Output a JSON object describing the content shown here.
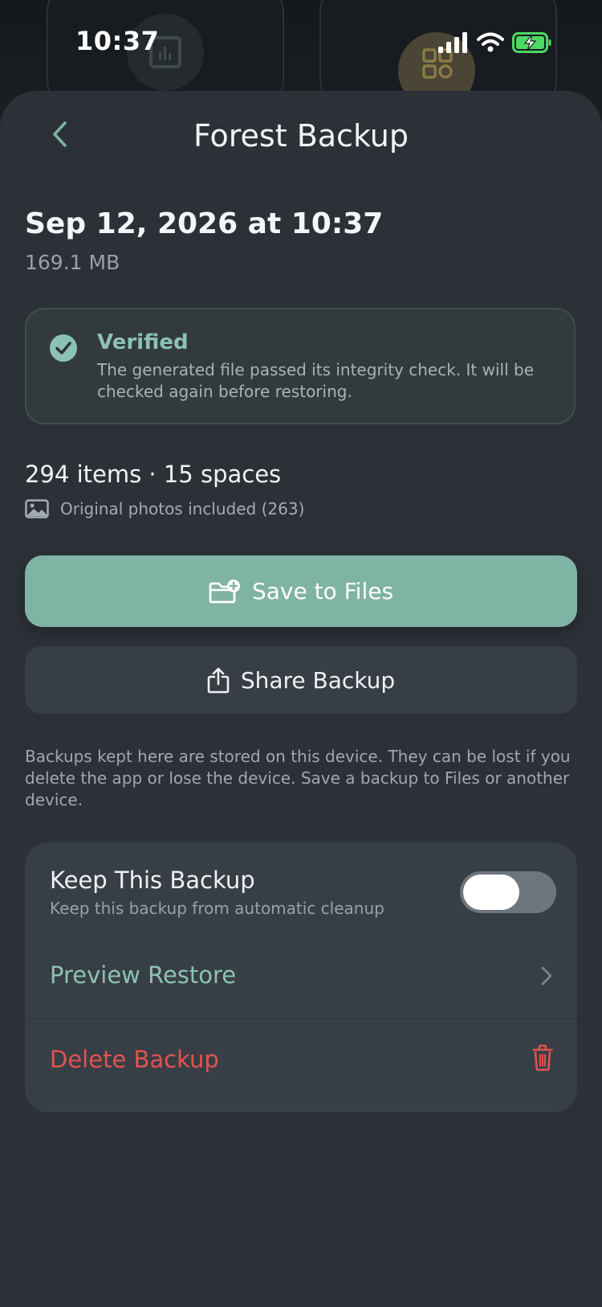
{
  "status_bar": {
    "time": "10:37"
  },
  "nav": {
    "title": "Forest Backup"
  },
  "backup": {
    "date": "Sep 12, 2026 at 10:37",
    "size": "169.1 MB"
  },
  "verified": {
    "title": "Verified",
    "text": "The generated file passed its integrity check. It will be checked again before restoring."
  },
  "contents": {
    "counts": "294 items · 15 spaces",
    "photos": "Original photos included (263)"
  },
  "actions": {
    "save_label": "Save to Files",
    "share_label": "Share Backup"
  },
  "disclaimer": "Backups kept here are stored on this device. They can be lost if you delete the app or lose the device. Save a backup to Files or another device.",
  "settings": {
    "keep_title": "Keep This Backup",
    "keep_subtitle": "Keep this backup from automatic cleanup",
    "keep_enabled": false,
    "preview_label": "Preview Restore",
    "delete_label": "Delete Backup"
  },
  "colors": {
    "accent": "#7fb3a4",
    "accent_text": "#8dc2b2",
    "danger": "#e3524f",
    "sheet_bg": "#2c3137"
  },
  "icons": {
    "back": "chevron-left-icon",
    "check": "check-circle-icon",
    "photo": "image-icon",
    "save": "folder-plus-icon",
    "share": "share-icon",
    "chevron": "chevron-right-icon",
    "trash": "trash-icon"
  }
}
